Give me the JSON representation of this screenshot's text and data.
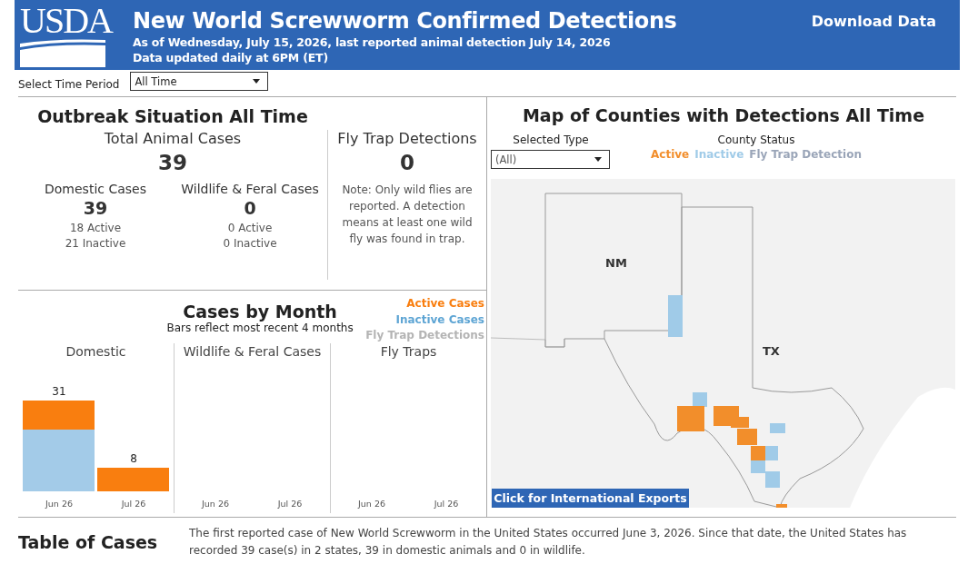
{
  "header": {
    "logo": "USDA",
    "title": "New World Screwworm Confirmed Detections",
    "subtitle": "As of Wednesday, July 15, 2026, last reported animal detection July 14, 2026",
    "update_note": "Data updated daily at 6PM (ET)",
    "download": "Download Data"
  },
  "time_filter": {
    "label": "Select Time Period",
    "value": "All Time"
  },
  "outbreak": {
    "title": "Outbreak Situation All Time",
    "total_label": "Total Animal Cases",
    "total": "39",
    "groups": [
      {
        "label": "Domestic Cases",
        "value": "39",
        "active": "18 Active",
        "inactive": "21 Inactive"
      },
      {
        "label": "Wildlife & Feral Cases",
        "value": "0",
        "active": "0 Active",
        "inactive": "0 Inactive"
      }
    ],
    "fly_label": "Fly Trap Detections",
    "fly_value": "0",
    "fly_note": "Note: Only wild flies are reported. A detection means at least one wild fly was found in trap."
  },
  "cases_by_month": {
    "title": "Cases by Month",
    "subtitle": "Bars reflect most recent 4 months",
    "legend": [
      {
        "label": "Active Cases",
        "color": "#f97e0f"
      },
      {
        "label": "Inactive Cases",
        "color": "#5ea5d4"
      },
      {
        "label": "Fly Trap Detections",
        "color": "#b4b4b4"
      }
    ],
    "panels": [
      {
        "title": "Domestic",
        "kind": "bars",
        "value_labels": [
          "31",
          "8"
        ],
        "axis_labels": [
          "Jun 26",
          "Jul 26"
        ]
      },
      {
        "title": "Wildlife & Feral Cases",
        "axis_labels": [
          "Jun 26",
          "Jul 26"
        ]
      },
      {
        "title": "Fly Traps",
        "axis_labels": [
          "Jun 26",
          "Jul 26"
        ]
      }
    ]
  },
  "map": {
    "title": "Map of Counties with Detections All Time",
    "type_label": "Selected Type",
    "type_value": "(All)",
    "status_label": "County Status",
    "legend": [
      {
        "label": "Active",
        "color": "#f28e2b"
      },
      {
        "label": "Inactive",
        "color": "#a0cbe8"
      },
      {
        "label": "Fly Trap Detection",
        "color": "#9aa5b8"
      }
    ],
    "state_labels": [
      "NM",
      "TX"
    ],
    "exports_button": "Click for International Exports"
  },
  "table": {
    "title": "Table of Cases",
    "summary": "The first reported case of New World Screwworm in the United States occurred June 3, 2026. Since that date, the United States has recorded 39 case(s) in 2 states, 39 in domestic animals and 0 in wildlife."
  }
}
